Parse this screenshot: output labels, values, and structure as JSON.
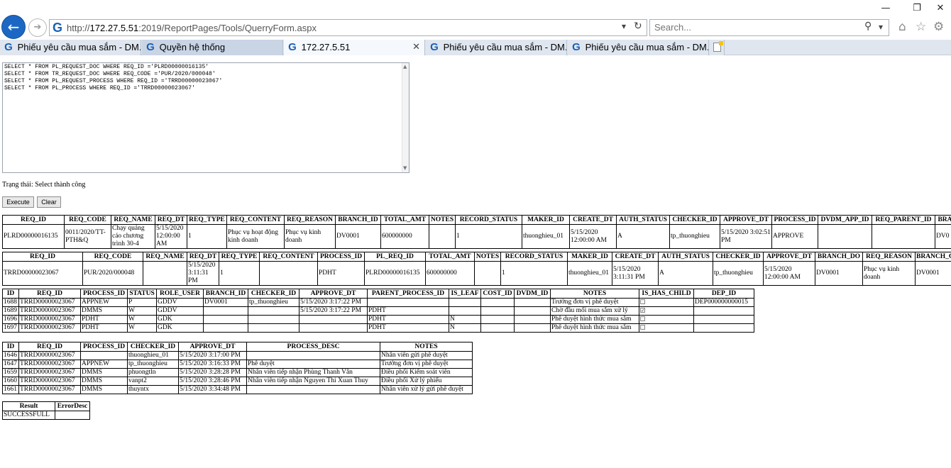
{
  "browser": {
    "url": "http://172.27.5.51:2019/ReportPages/Tools/QuerryForm.aspx",
    "url_prefix": "http://",
    "url_host": "172.27.5.51",
    "url_rest": ":2019/ReportPages/Tools/QuerryForm.aspx",
    "search_placeholder": "Search...",
    "tabs": [
      {
        "label": "Phiếu yêu cầu mua sắm - DM..."
      },
      {
        "label": "Quyền hệ thống"
      },
      {
        "label": "172.27.5.51"
      },
      {
        "label": "Phiếu yêu cầu mua sắm - DM..."
      },
      {
        "label": "Phiếu yêu cầu mua sắm - DM..."
      }
    ]
  },
  "query": {
    "sql": "SELECT * FROM PL_REQUEST_DOC WHERE REQ_ID ='PLRD00000016135'\nSELECT * FROM TR_REQUEST_DOC WHERE REQ_CODE ='PUR/2020/000048'\nSELECT * FROM PL_REQUEST_PROCESS WHERE REQ_ID ='TRRD00000023067'\nSELECT * FROM PL_PROCESS WHERE REQ_ID ='TRRD00000023067'",
    "status": "Trạng thái: Select thành công",
    "execute_label": "Execute",
    "clear_label": "Clear"
  },
  "tables": {
    "t1": {
      "headers": [
        "REQ_ID",
        "REQ_CODE",
        "REQ_NAME",
        "REQ_DT",
        "REQ_TYPE",
        "REQ_CONTENT",
        "REQ_REASON",
        "BRANCH_ID",
        "TOTAL_AMT",
        "NOTES",
        "RECORD_STATUS",
        "MAKER_ID",
        "CREATE_DT",
        "AUTH_STATUS",
        "CHECKER_ID",
        "APPROVE_DT",
        "PROCESS_ID",
        "DVDM_APP_ID",
        "REQ_PARENT_ID",
        "BRA"
      ],
      "rows": [
        [
          "PLRD00000016135",
          "0011/2020/TT-PTH&Q",
          "Chạy quảng cáo chương trình 30-4",
          "5/15/2020 12:00:00 AM",
          "1",
          "Phục vụ hoạt động kinh doanh",
          "Phục vụ kinh doanh",
          "DV0001",
          "600000000",
          "",
          "1",
          "thuonghieu_01",
          "5/15/2020 12:00:00 AM",
          "A",
          "tp_thuonghieu",
          "5/15/2020 3:02:51 PM",
          "APPROVE",
          "",
          "",
          "DV0"
        ]
      ]
    },
    "t2": {
      "headers": [
        "REQ_ID",
        "REQ_CODE",
        "REQ_NAME",
        "REQ_DT",
        "REQ_TYPE",
        "REQ_CONTENT",
        "PROCESS_ID",
        "PL_REQ_ID",
        "TOTAL_AMT",
        "NOTES",
        "RECORD_STATUS",
        "MAKER_ID",
        "CREATE_DT",
        "AUTH_STATUS",
        "CHECKER_ID",
        "APPROVE_DT",
        "BRANCH_DO",
        "REQ_REASON",
        "BRANCH_CREAT"
      ],
      "rows": [
        [
          "TRRD00000023067",
          "PUR/2020/000048",
          "",
          "5/15/2020 3:11:31 PM",
          "1",
          "",
          "PDHT",
          "PLRD00000016135",
          "600000000",
          "",
          "1",
          "thuonghieu_01",
          "5/15/2020 3:11:31 PM",
          "A",
          "tp_thuonghieu",
          "5/15/2020 12:00:00 AM",
          "DV0001",
          "Phục vụ kinh doanh",
          "DV0001"
        ]
      ]
    },
    "t3": {
      "headers": [
        "ID",
        "REQ_ID",
        "PROCESS_ID",
        "STATUS",
        "ROLE_USER",
        "BRANCH_ID",
        "CHECKER_ID",
        "APPROVE_DT",
        "PARENT_PROCESS_ID",
        "IS_LEAF",
        "COST_ID",
        "DVDM_ID",
        "NOTES",
        "IS_HAS_CHILD",
        "DEP_ID"
      ],
      "rows": [
        [
          "1688",
          "TRRD00000023067",
          "APPNEW",
          "P",
          "GDDV",
          "DV0001",
          "tp_thuonghieu",
          "5/15/2020 3:17:22 PM",
          "",
          "",
          "",
          "",
          "Trưởng đơn vị phê duyệt",
          "unchecked",
          "DEP000000000015"
        ],
        [
          "1689",
          "TRRD00000023067",
          "DMMS",
          "W",
          "GDDV",
          "",
          "",
          "5/15/2020 3:17:22 PM",
          "PDHT",
          "",
          "",
          "",
          "Chờ đầu mối mua sắm xử lý",
          "checked",
          ""
        ],
        [
          "1696",
          "TRRD00000023067",
          "PDHT",
          "W",
          "GDK",
          "",
          "",
          "",
          "PDHT",
          "N",
          "",
          "",
          "Phê duyệt hình thức mua sắm",
          "unchecked",
          ""
        ],
        [
          "1697",
          "TRRD00000023067",
          "PDHT",
          "W",
          "GDK",
          "",
          "",
          "",
          "PDHT",
          "N",
          "",
          "",
          "Phê duyệt hình thức mua sắm",
          "unchecked",
          ""
        ]
      ]
    },
    "t4": {
      "headers": [
        "ID",
        "REQ_ID",
        "PROCESS_ID",
        "CHECKER_ID",
        "APPROVE_DT",
        "PROCESS_DESC",
        "NOTES"
      ],
      "rows": [
        [
          "1646",
          "TRRD00000023067",
          "",
          "thuonghieu_01",
          "5/15/2020 3:17:00 PM",
          "",
          "Nhân viên gửi phê duyệt"
        ],
        [
          "1647",
          "TRRD00000023067",
          "APPNEW",
          "tp_thuonghieu",
          "5/15/2020 3:16:33 PM",
          "Phê duyệt",
          "Trưởng đơn vị phê duyệt"
        ],
        [
          "1659",
          "TRRD00000023067",
          "DMMS",
          "phuongtln",
          "5/15/2020 3:28:28 PM",
          "Nhân viên tiếp nhận Phùng Thanh Vân",
          "Điều phối Kiểm soát viên"
        ],
        [
          "1660",
          "TRRD00000023067",
          "DMMS",
          "vanpt2",
          "5/15/2020 3:28:46 PM",
          "Nhân viên tiếp nhận Nguyen Thi Xuan Thuy",
          "Điều phối Xử lý phiếu"
        ],
        [
          "1661",
          "TRRD00000023067",
          "DMMS",
          "thuyntx",
          "5/15/2020 3:34:48 PM",
          "",
          "Nhân viên xử lý gửi phê duyệt"
        ]
      ]
    },
    "t5": {
      "headers": [
        "Result",
        "ErrorDesc"
      ],
      "rows": [
        [
          "SUCCESSFULL",
          ""
        ]
      ]
    }
  }
}
